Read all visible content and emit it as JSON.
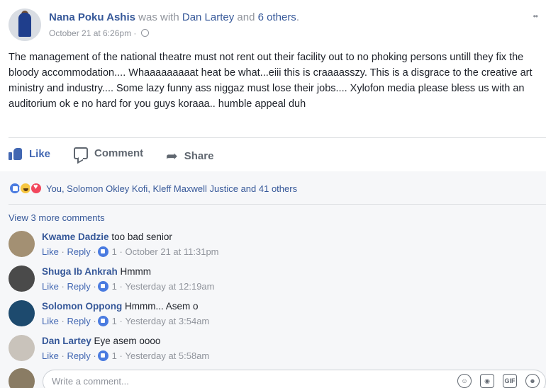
{
  "post": {
    "author": "Nana Poku Ashis",
    "with_text": "was with",
    "tagged": "Dan Lartey",
    "and_text": "and",
    "others": "6 others",
    "period": ".",
    "timestamp": "October 21 at 6:26pm",
    "dot": "·",
    "text": "The management of the national theatre must not rent out their facility out to no phoking persons untill they fix the bloody accommodation.... Whaaaaaaaaat heat be what...eiii this is craaaasszy. This is a disgrace to the creative art ministry and industry.... Some lazy funny ass niggaz must lose their jobs.... Xylofon media please bless us with an auditorium ok e no hard for you guys koraaa.. humble appeal duh"
  },
  "actions": {
    "like": "Like",
    "comment": "Comment",
    "share": "Share"
  },
  "reactions": {
    "summary": "You, Solomon Okley Kofi, Kleff Maxwell Justice and 41 others",
    "icons": [
      "like-icon",
      "haha-icon",
      "love-icon"
    ]
  },
  "view_more": "View 3 more comments",
  "comment_ui": {
    "like": "Like",
    "reply": "Reply",
    "sep": "·"
  },
  "comments": [
    {
      "name": "Kwame Dadzie",
      "text": "too bad senior",
      "likes": "1",
      "time": "October 21 at 11:31pm"
    },
    {
      "name": "Shuga Ib Ankrah",
      "text": "Hmmm",
      "likes": "1",
      "time": "Yesterday at 12:19am"
    },
    {
      "name": "Solomon Oppong",
      "text": "Hmmm... Asem o",
      "likes": "1",
      "time": "Yesterday at 3:54am"
    },
    {
      "name": "Dan Lartey",
      "text": "Eye asem oooo",
      "likes": "1",
      "time": "Yesterday at 5:58am"
    }
  ],
  "composer": {
    "placeholder": "Write a comment...",
    "gif": "GIF"
  },
  "colors": {
    "link": "#365899",
    "accent": "#4267b2",
    "muted": "#90949c",
    "background_gray": "#f6f7f9"
  }
}
